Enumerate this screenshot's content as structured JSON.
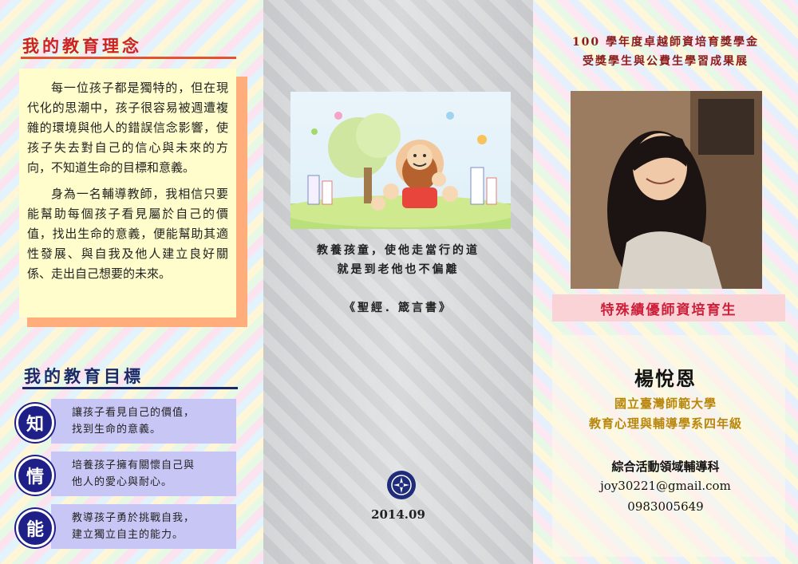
{
  "left": {
    "philosophy_heading": "我的教育理念",
    "philosophy_paragraphs": [
      "每一位孩子都是獨特的，但在現代化的思潮中，孩子很容易被週遭複雜的環境與他人的錯誤信念影響，使孩子失去對自己的信心與未來的方向，不知道生命的目標和意義。",
      "身為一名輔導教師，我相信只要能幫助每個孩子看見屬於自己的價值，找出生命的意義，便能幫助其適性發展、與自我及他人建立良好關係、走出自己想要的未來。"
    ],
    "goals_heading": "我的教育目標",
    "goals": [
      {
        "char": "知",
        "line1": "讓孩子看見自己的價值，",
        "line2": "找到生命的意義。"
      },
      {
        "char": "情",
        "line1": "培養孩子擁有關懷自己與",
        "line2": "他人的愛心與耐心。"
      },
      {
        "char": "能",
        "line1": "教導孩子勇於挑戰自我，",
        "line2": "建立獨立自主的能力。"
      }
    ]
  },
  "middle": {
    "verse_line1": "教養孩童，使他走當行的道",
    "verse_line2": "就是到老他也不偏離",
    "verse_source": "《聖經．箴言書》",
    "date": "2014.09"
  },
  "right": {
    "title_line1": "100 學年度卓越師資培育獎學金",
    "title_line2": "受獎學生與公費生學習成果展",
    "program": "特殊績優師資培育生",
    "name": "楊悅恩",
    "university": "國立臺灣師範大學",
    "department": "教育心理與輔導學系四年級",
    "subject": "綜合活動領域輔導科",
    "email": "joy30221@gmail.com",
    "phone": "0983005649"
  },
  "colors": {
    "heading_red": "#cc2222",
    "heading_navy": "#1a2a66",
    "card_yellow": "#fffdcb",
    "goal_purple": "#c8c6f4",
    "program_pink": "#f9d3d6"
  }
}
